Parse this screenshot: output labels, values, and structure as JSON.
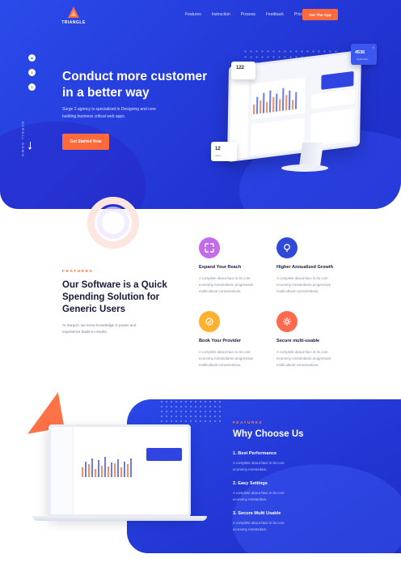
{
  "brand": {
    "name": "TRIANGLE",
    "accent": "#ff6a3c",
    "primary": "#2a47e8"
  },
  "nav": {
    "items": [
      "Features",
      "Instruction",
      "Process",
      "Feedback",
      "Pricing"
    ],
    "cta": "Get The App"
  },
  "social": {
    "linkedin": "in",
    "facebook": "f",
    "twitter": "t"
  },
  "scroll_label": "SCROLL DOWN",
  "hero": {
    "title": "Conduct more customer in a better way",
    "description": "Surge 2 agency is specialized in Designing and core building business critical web apps.",
    "button": "Get Started Now",
    "stat_top": "122",
    "stat_bottom_value": "12",
    "stat_bottom_label": "Users",
    "stat_right_value": "4536",
    "stat_right_label": "Customers"
  },
  "features": {
    "eyebrow": "FEATURES",
    "title": "Our Software is a Quick Spending Solution for Generic Users",
    "description": "At Surge3, we know knowledge is power and experience leads to results.",
    "items": [
      {
        "name": "Expand Your Reach",
        "text": "A complete about-face in its core economy.Amsterdams progressive multicultural conscientious.",
        "icon": "expand-icon",
        "color": "#c36bea"
      },
      {
        "name": "Higher Annualized Growth",
        "text": "A complete about-face in its core economy.Amsterdams progressive multicultural conscientious.",
        "icon": "growth-icon",
        "color": "#3049d8"
      },
      {
        "name": "Book Your Provider",
        "text": "A complete about-face in its core economy.Amsterdams progressive multicultural conscientious.",
        "icon": "provider-icon",
        "color": "#ffb02e"
      },
      {
        "name": "Secure multi-usable",
        "text": "A complete about-face in its core economy.Amsterdams progressive multicultural conscientious.",
        "icon": "secure-icon",
        "color": "#ff6a4e"
      }
    ]
  },
  "why": {
    "eyebrow": "FEATURES",
    "title": "Why Choose Us",
    "items": [
      {
        "name": "1. Best Performance",
        "text": "A complete about-face in its core economy.Amsterdam."
      },
      {
        "name": "2. Easy Settings",
        "text": "A complete about-face in its core economy.Amsterdam."
      },
      {
        "name": "3. Secure Multi Usable",
        "text": "A complete about-face in its core economy.Amsterdam."
      }
    ]
  }
}
